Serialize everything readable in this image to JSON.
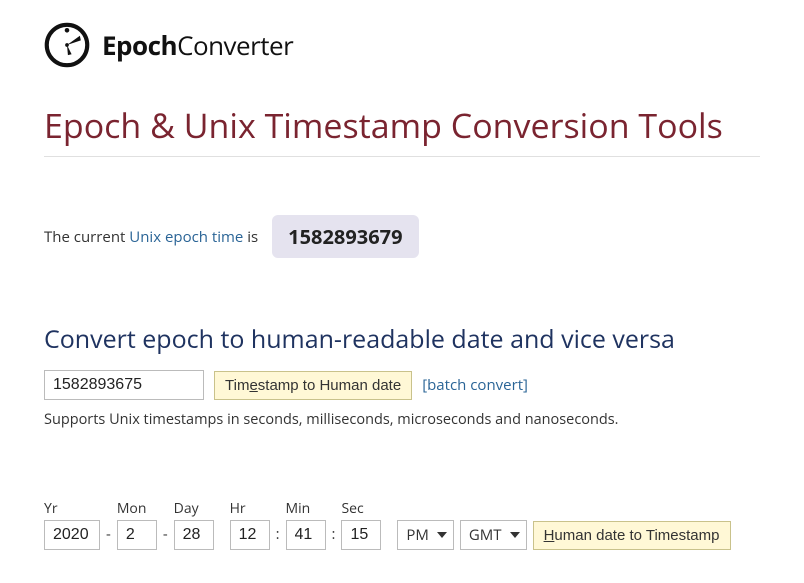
{
  "logo": {
    "bold": "Epoch",
    "light": "Converter"
  },
  "page_title": "Epoch & Unix Timestamp Conversion Tools",
  "current": {
    "prefix": "The current ",
    "link_text": "Unix epoch time",
    "suffix": " is",
    "value": "1582893679"
  },
  "section1": {
    "heading": "Convert epoch to human-readable date and vice versa",
    "timestamp_value": "1582893675",
    "button_prefix": "Tim",
    "button_ul": "e",
    "button_suffix": "stamp to Human date",
    "batch_link": "[batch convert]",
    "help": "Supports Unix timestamps in seconds, milliseconds, microseconds and nanoseconds."
  },
  "date_form": {
    "labels": {
      "yr": "Yr",
      "mon": "Mon",
      "day": "Day",
      "hr": "Hr",
      "min": "Min",
      "sec": "Sec"
    },
    "values": {
      "yr": "2020",
      "mon": "2",
      "day": "28",
      "hr": "12",
      "min": "41",
      "sec": "15"
    },
    "ampm": "PM",
    "tz": "GMT",
    "button_ul": "H",
    "button_suffix": "uman date to Timestamp"
  }
}
